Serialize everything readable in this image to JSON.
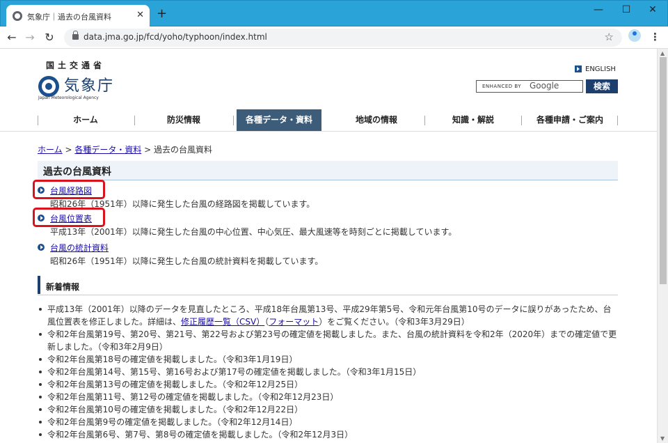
{
  "browser": {
    "tab_title": "気象庁｜過去の台風資料",
    "tab_close": "✕",
    "new_tab": "+",
    "url": "data.jma.go.jp/fcd/yoho/typhoon/index.html",
    "icons": {
      "back": "arrow-left-icon",
      "forward": "arrow-right-icon",
      "reload": "reload-icon",
      "lock": "lock-icon",
      "star": "star-icon",
      "profile": "profile-icon",
      "menu": "more-vert-icon"
    }
  },
  "header": {
    "ministry": "国土交通省",
    "agency_name": "気象庁",
    "agency_english": "Japan Meteorological Agency",
    "english_link": "ENGLISH",
    "search_prefix": "ENHANCED BY",
    "search_brand": "Google",
    "search_button": "検索"
  },
  "global_nav": [
    {
      "label": "ホーム"
    },
    {
      "label": "防災情報"
    },
    {
      "label": "各種データ・資料",
      "active": true
    },
    {
      "label": "地域の情報"
    },
    {
      "label": "知識・解説"
    },
    {
      "label": "各種申請・ご案内"
    }
  ],
  "breadcrumb": {
    "home": "ホーム",
    "sep1": " > ",
    "data": "各種データ・資料",
    "sep2": " > ",
    "current": "過去の台風資料"
  },
  "page_title": "過去の台風資料",
  "links": [
    {
      "label": "台風経路図",
      "desc": "昭和26年（1951年）以降に発生した台風の経路図を掲載しています。",
      "highlighted": true
    },
    {
      "label": "台風位置表",
      "desc": "平成13年（2001年）以降に発生した台風の中心位置、中心気圧、最大風速等を時刻ごとに掲載しています。",
      "highlighted": true
    },
    {
      "label": "台風の統計資料",
      "desc": "昭和26年（1951年）以降に発生した台風の統計資料を掲載しています。",
      "highlighted": false
    }
  ],
  "news": {
    "title": "新着情報",
    "item0": {
      "part1": "平成13年（2001年）以降のデータを見直したところ、平成18年台風第13号、平成29年第5号、令和元年台風第10号のデータに誤りがあったため、台風位置表を修正しました。詳細は、",
      "link1": "修正履歴一覧（CSV）",
      "part2": "（",
      "link2": "フォーマット",
      "part3": "）をご覧ください。（令和3年3月29日）"
    },
    "items": [
      "令和2年台風第19号、第20号、第21号、第22号および第23号の確定値を掲載しました。また、台風の統計資料を令和2年（2020年）までの確定値で更新しました。（令和3年2月9日）",
      "令和2年台風第18号の確定値を掲載しました。（令和3年1月19日）",
      "令和2年台風第14号、第15号、第16号および第17号の確定値を掲載しました。（令和3年1月15日）",
      "令和2年台風第13号の確定値を掲載しました。（令和2年12月25日）",
      "令和2年台風第11号、第12号の確定値を掲載しました。（令和2年12月23日）",
      "令和2年台風第10号の確定値を掲載しました。（令和2年12月22日）",
      "令和2年台風第9号の確定値を掲載しました。（令和2年12月14日）",
      "令和2年台風第6号、第7号、第8号の確定値を掲載しました。（令和2年12月3日）"
    ]
  },
  "colors": {
    "accent": "#1c3f6e",
    "highlight": "#d9121b",
    "link": "#1a0dab",
    "titlebar": "#2aa3d8"
  }
}
